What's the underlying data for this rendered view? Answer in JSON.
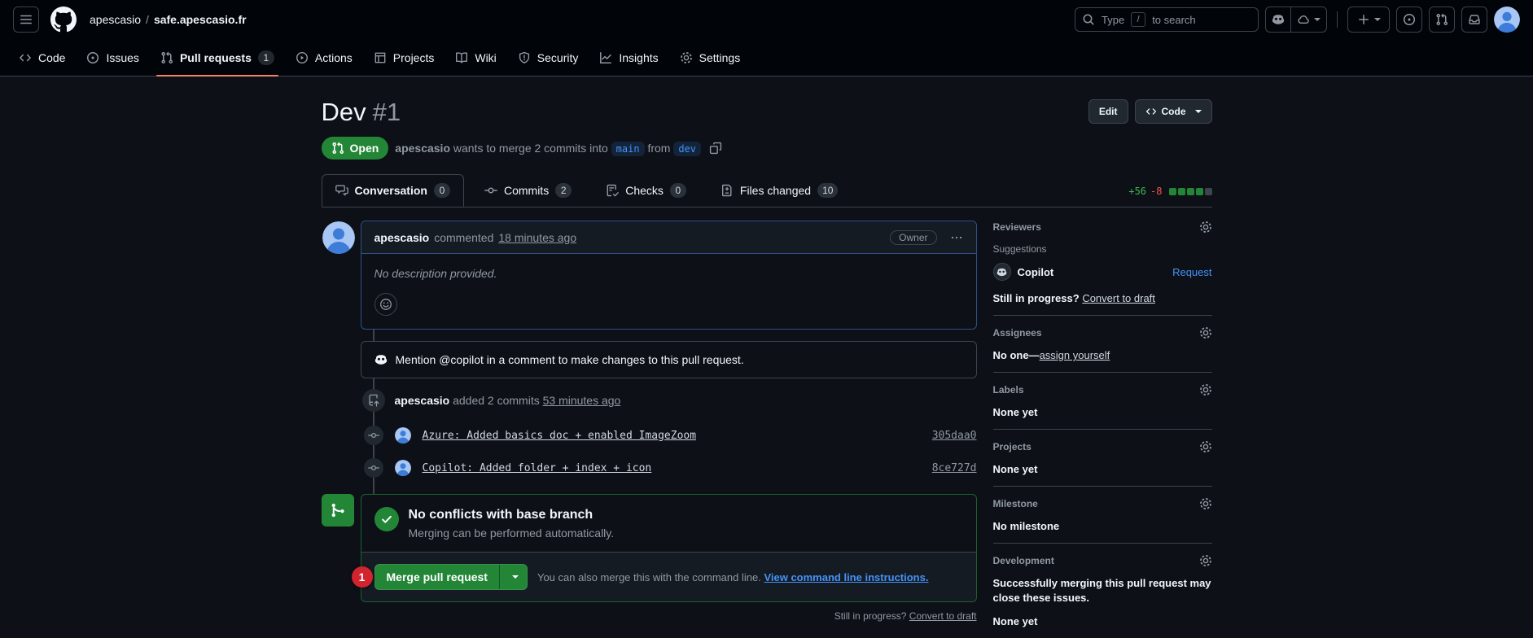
{
  "colors": {
    "open_green": "#238636",
    "tab_accent_orange": "#f78166",
    "link_blue": "#4493f8",
    "additions_green": "#3fb950",
    "deletions_red": "#f85149",
    "annotation_red": "#d1242f"
  },
  "header": {
    "owner": "apescasio",
    "separator": "/",
    "repo": "safe.apescasio.fr",
    "search": {
      "pre": "Type",
      "key": "/",
      "post": "to search"
    },
    "icons": [
      "three-bars",
      "github-logo",
      "search",
      "copilot",
      "cloud",
      "plus",
      "issue-opened",
      "git-pull-request",
      "inbox",
      "avatar"
    ]
  },
  "repo_nav": {
    "items": [
      {
        "label": "Code"
      },
      {
        "label": "Issues"
      },
      {
        "label": "Pull requests",
        "count": "1"
      },
      {
        "label": "Actions"
      },
      {
        "label": "Projects"
      },
      {
        "label": "Wiki"
      },
      {
        "label": "Security"
      },
      {
        "label": "Insights"
      },
      {
        "label": "Settings"
      }
    ]
  },
  "pr": {
    "title": "Dev",
    "number": "#1",
    "edit_button": "Edit",
    "code_button": "Code",
    "state": "Open",
    "merge_sentence": {
      "author": "apescasio",
      "middle": "wants to merge 2 commits into",
      "base_branch": "main",
      "from_word": "from",
      "head_branch": "dev"
    },
    "tabs": [
      {
        "label": "Conversation",
        "count": "0"
      },
      {
        "label": "Commits",
        "count": "2"
      },
      {
        "label": "Checks",
        "count": "0"
      },
      {
        "label": "Files changed",
        "count": "10"
      }
    ],
    "diffstat": {
      "additions": "+56",
      "deletions": "-8"
    }
  },
  "conversation": {
    "comment": {
      "author": "apescasio",
      "action": "commented",
      "time": "18 minutes ago",
      "role_badge": "Owner",
      "body": "No description provided."
    },
    "copilot_banner": "Mention @copilot in a comment to make changes to this pull request.",
    "event": {
      "author": "apescasio",
      "action": "added 2 commits",
      "time": "53 minutes ago"
    },
    "commits": [
      {
        "message": "Azure: Added basics doc + enabled ImageZoom",
        "sha": "305daa0"
      },
      {
        "message": "Copilot: Added folder + index + icon",
        "sha": "8ce727d"
      }
    ],
    "merge_box": {
      "status_title": "No conflicts with base branch",
      "status_subtitle": "Merging can be performed automatically.",
      "merge_button": "Merge pull request",
      "cmdline_text": "You can also merge this with the command line.",
      "cmdline_link": "View command line instructions.",
      "annotation_marker": "1"
    },
    "draft_prompt": {
      "text": "Still in progress?",
      "link": "Convert to draft"
    }
  },
  "sidebar": {
    "reviewers": {
      "title": "Reviewers",
      "suggestions_label": "Suggestions",
      "suggested_reviewer": "Copilot",
      "request_link": "Request",
      "draft_text": "Still in progress?",
      "draft_link": "Convert to draft"
    },
    "assignees": {
      "title": "Assignees",
      "empty_text": "No one—",
      "assign_link": "assign yourself"
    },
    "labels": {
      "title": "Labels",
      "empty": "None yet"
    },
    "projects": {
      "title": "Projects",
      "empty": "None yet"
    },
    "milestone": {
      "title": "Milestone",
      "empty": "No milestone"
    },
    "development": {
      "title": "Development",
      "description": "Successfully merging this pull request may close these issues.",
      "empty": "None yet"
    }
  }
}
